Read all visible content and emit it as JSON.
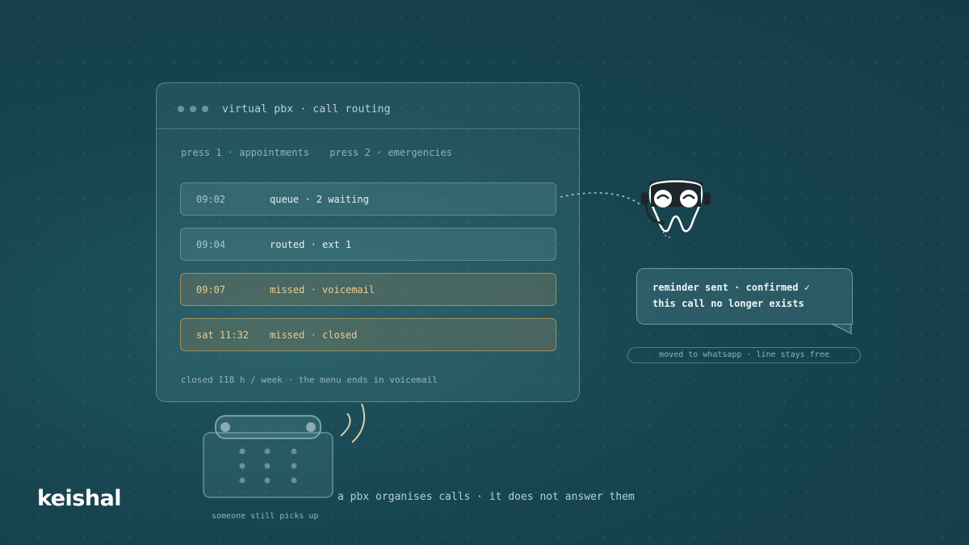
{
  "window": {
    "title": "virtual pbx · call routing",
    "menu": [
      "press 1 · appointments",
      "press 2 · emergencies"
    ],
    "calls": [
      {
        "time": "09:02",
        "event": "queue · 2 waiting",
        "missed": false
      },
      {
        "time": "09:04",
        "event": "routed · ext 1",
        "missed": false
      },
      {
        "time": "09:07",
        "event": "missed · voicemail",
        "missed": true
      },
      {
        "time": "sat 11:32",
        "event": "missed · closed",
        "missed": true
      }
    ],
    "footer": "closed 118 h / week · the menu ends in voicemail"
  },
  "bubble": {
    "line1": "reminder sent · confirmed ✓",
    "line2": "this call no longer exists"
  },
  "pill": "moved to whatsapp · line stays free",
  "caption": {
    "main": "a pbx organises calls · it does not answer them",
    "sub": "someone still picks up"
  },
  "brand": {
    "logo": "keishal"
  },
  "colors": {
    "background": "#17444f",
    "missed_accent": "#eecb8e",
    "text_light": "#eef5f5"
  },
  "icons": {
    "mascot": "tooth-headset-mascot",
    "phone": "desk-phone-icon"
  }
}
